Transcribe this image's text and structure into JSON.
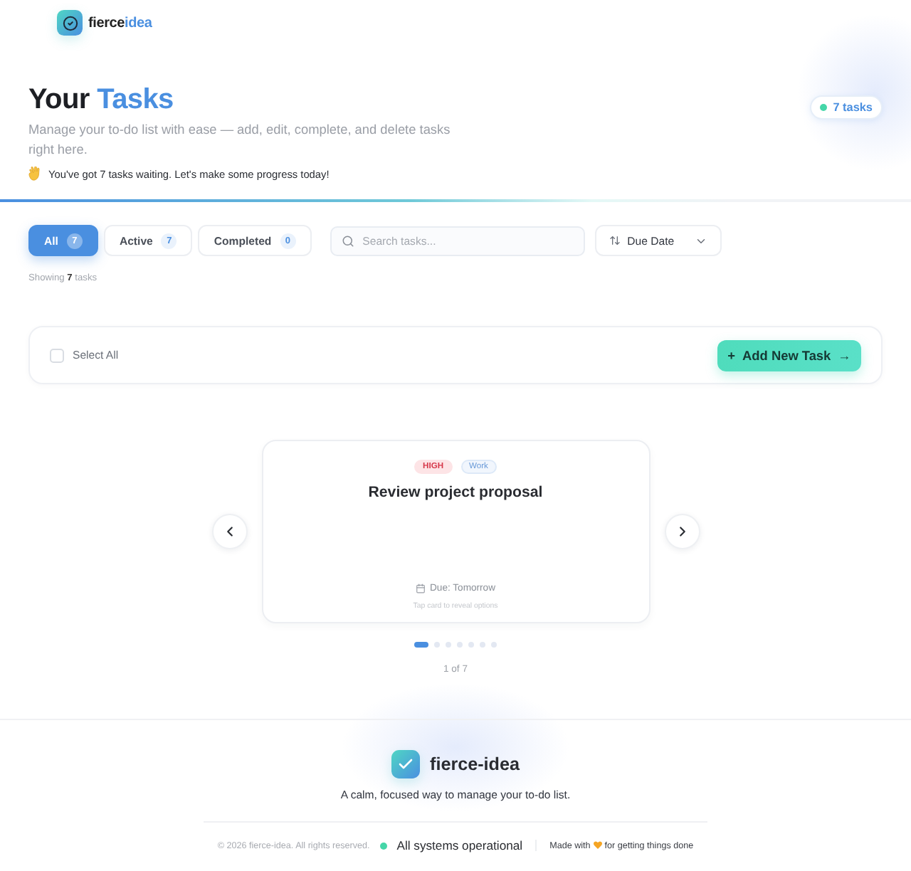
{
  "header": {
    "brand": "fierce",
    "brand_accent": "idea"
  },
  "hero": {
    "title": "Your",
    "title_accent": "Tasks",
    "subtitle": "Manage your to-do list with ease — add, edit, complete, and delete tasks right here.",
    "greeting": "You've got 7 tasks waiting. Let's make some progress today!",
    "badge": {
      "count": "7",
      "label": "tasks"
    }
  },
  "filters": [
    {
      "label": "All",
      "count": "7",
      "selected": true
    },
    {
      "label": "Active",
      "count": "7",
      "selected": false
    },
    {
      "label": "Completed",
      "count": "0",
      "selected": false
    }
  ],
  "search": {
    "placeholder": "Search tasks..."
  },
  "sort": {
    "value": "Due Date"
  },
  "summary": "Showing **7** tasks",
  "toolbar": {
    "select_all": {
      "label": "Select All",
      "checked": false
    },
    "add_button": {
      "prefix": "+",
      "label": "Add New Task",
      "suffix": "→"
    }
  },
  "carousel": {
    "card": {
      "priority": {
        "label": "HIGH",
        "kind": "high"
      },
      "category": "Work",
      "title": "Review project proposal",
      "due": "Due: Tomorrow",
      "hint": "Tap card to reveal options"
    },
    "dots": [
      {
        "selected": true
      },
      {
        "selected": false
      },
      {
        "selected": false
      },
      {
        "selected": false
      },
      {
        "selected": false
      },
      {
        "selected": false
      },
      {
        "selected": false
      }
    ],
    "position": "1 of 7"
  },
  "footer": {
    "brand": "fierce-idea",
    "tagline": "A calm, focused way to manage your to-do list.",
    "copyright": "© 2026 fierce-idea. All rights reserved.",
    "status": "All systems operational",
    "made_with": "Made with",
    "made_for": "for getting things done"
  }
}
